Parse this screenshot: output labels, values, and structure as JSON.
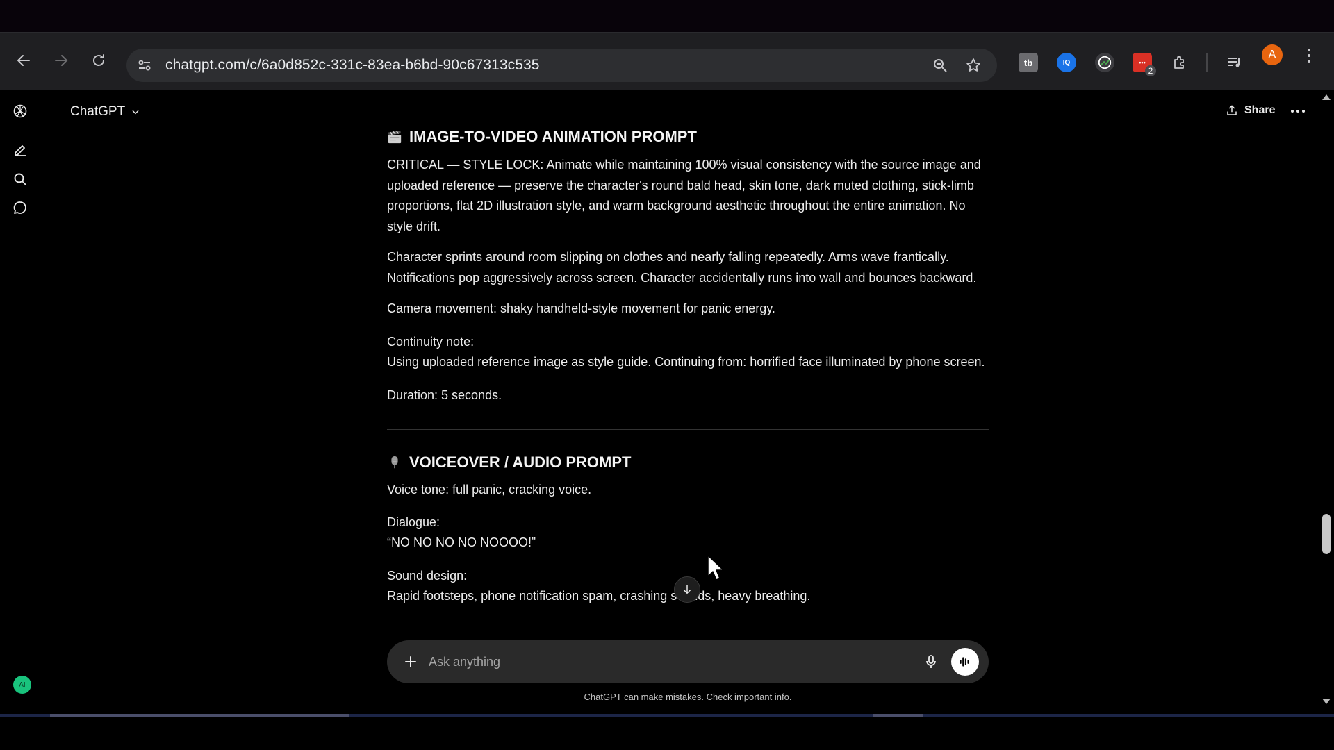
{
  "browser": {
    "url": "chatgpt.com/c/6a0d852c-331c-83ea-b6bd-90c67313c535",
    "extensions": [
      {
        "name": "tb-extension",
        "label": "tb",
        "color": "#6b6b6f"
      },
      {
        "name": "iq-extension",
        "label": "IQ",
        "color": "#1a73e8"
      },
      {
        "name": "gauge-extension",
        "label": "",
        "color": "#3c3c40"
      },
      {
        "name": "red-extension",
        "label": "",
        "color": "#d93025",
        "badge": "2"
      }
    ],
    "profile_initial": "A"
  },
  "app": {
    "model_name": "ChatGPT",
    "share_label": "Share",
    "sidebar_avatar": "AI"
  },
  "message": {
    "section1": {
      "title": "IMAGE-TO-VIDEO ANIMATION PROMPT",
      "p1": "CRITICAL — STYLE LOCK: Animate while maintaining 100% visual consistency with the source image and uploaded reference — preserve the character's round bald head, skin tone, dark muted clothing, stick-limb proportions, flat 2D illustration style, and warm background aesthetic throughout the entire animation. No style drift.",
      "p2": "Character sprints around room slipping on clothes and nearly falling repeatedly. Arms wave frantically. Notifications pop aggressively across screen. Character accidentally runs into wall and bounces backward.",
      "p3": "Camera movement: shaky handheld-style movement for panic energy.",
      "p4_label": "Continuity note:",
      "p4_text": "Using uploaded reference image as style guide. Continuing from: horrified face illuminated by phone screen.",
      "p5": "Duration: 5 seconds."
    },
    "section2": {
      "title": "VOICEOVER / AUDIO PROMPT",
      "p1": "Voice tone: full panic, cracking voice.",
      "p2_label": "Dialogue:",
      "p2_text": "“NO NO NO NO NOOOO!”",
      "p3_label": "Sound design:",
      "p3_text": "Rapid footsteps, phone notification spam, crashing sounds, heavy breathing."
    }
  },
  "composer": {
    "placeholder": "Ask anything"
  },
  "footer": {
    "disclaimer": "ChatGPT can make mistakes. Check important info."
  }
}
